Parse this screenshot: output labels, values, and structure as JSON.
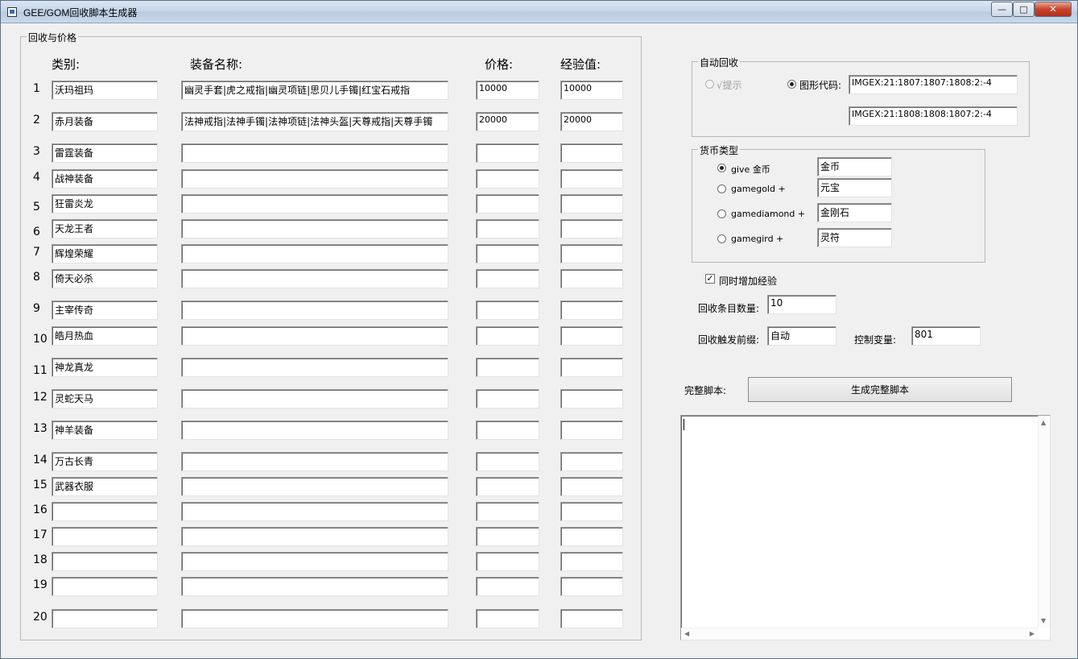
{
  "window": {
    "title": "GEE/GOM回收脚本生成器",
    "minimize": "—",
    "maximize": "□",
    "close": "✕"
  },
  "recycle": {
    "legend": "回收与价格",
    "headers": {
      "category": "类别:",
      "name": "装备名称:",
      "price": "价格:",
      "exp": "经验值:"
    },
    "rows": [
      {
        "num": "1",
        "category": "沃玛祖玛",
        "name": "幽灵手套|虎之戒指|幽灵项链|思贝儿手镯|红宝石戒指",
        "price": "10000",
        "exp": "10000"
      },
      {
        "num": "2",
        "category": "赤月装备",
        "name": "法神戒指|法神手镯|法神项链|法神头盔|天尊戒指|天尊手镯",
        "price": "20000",
        "exp": "20000"
      },
      {
        "num": "3",
        "category": "雷霆装备",
        "name": "",
        "price": "",
        "exp": ""
      },
      {
        "num": "4",
        "category": "战神装备",
        "name": "",
        "price": "",
        "exp": ""
      },
      {
        "num": "5",
        "category": "狂雷炎龙",
        "name": "",
        "price": "",
        "exp": ""
      },
      {
        "num": "6",
        "category": "天龙王者",
        "name": "",
        "price": "",
        "exp": ""
      },
      {
        "num": "7",
        "category": "辉煌荣耀",
        "name": "",
        "price": "",
        "exp": ""
      },
      {
        "num": "8",
        "category": "倚天必杀",
        "name": "",
        "price": "",
        "exp": ""
      },
      {
        "num": "9",
        "category": "主宰传奇",
        "name": "",
        "price": "",
        "exp": ""
      },
      {
        "num": "10",
        "category": "皓月热血",
        "name": "",
        "price": "",
        "exp": ""
      },
      {
        "num": "11",
        "category": "神龙真龙",
        "name": "",
        "price": "",
        "exp": ""
      },
      {
        "num": "12",
        "category": "灵蛇天马",
        "name": "",
        "price": "",
        "exp": ""
      },
      {
        "num": "13",
        "category": "神羊装备",
        "name": "",
        "price": "",
        "exp": ""
      },
      {
        "num": "14",
        "category": "万古长青",
        "name": "",
        "price": "",
        "exp": ""
      },
      {
        "num": "15",
        "category": "武器衣服",
        "name": "",
        "price": "",
        "exp": ""
      },
      {
        "num": "16",
        "category": "",
        "name": "",
        "price": "",
        "exp": ""
      },
      {
        "num": "17",
        "category": "",
        "name": "",
        "price": "",
        "exp": ""
      },
      {
        "num": "18",
        "category": "",
        "name": "",
        "price": "",
        "exp": ""
      },
      {
        "num": "19",
        "category": "",
        "name": "",
        "price": "",
        "exp": ""
      },
      {
        "num": "20",
        "category": "",
        "name": "",
        "price": "",
        "exp": ""
      }
    ]
  },
  "auto_recycle": {
    "legend": "自动回收",
    "option_tip": "√提示",
    "option_image": "图形代码:",
    "code1": "IMGEX:21:1807:1807:1808:2:-4",
    "code2": "IMGEX:21:1808:1808:1807:2:-4"
  },
  "currency": {
    "legend": "货币类型",
    "options": [
      {
        "label": "give 金币",
        "value": "金币",
        "checked": true
      },
      {
        "label": "gamegold +",
        "value": "元宝",
        "checked": false
      },
      {
        "label": "gamediamond +",
        "value": "金刚石",
        "checked": false
      },
      {
        "label": "gamegird +",
        "value": "灵符",
        "checked": false
      }
    ]
  },
  "settings": {
    "add_exp_label": "同时增加经验",
    "add_exp_checked": "✓",
    "count_label": "回收条目数量:",
    "count_value": "10",
    "prefix_label": "回收触发前缀:",
    "prefix_value": "自动",
    "var_label": "控制变量:",
    "var_value": "801"
  },
  "script": {
    "label": "完整脚本:",
    "generate_button": "生成完整脚本",
    "content": ""
  }
}
